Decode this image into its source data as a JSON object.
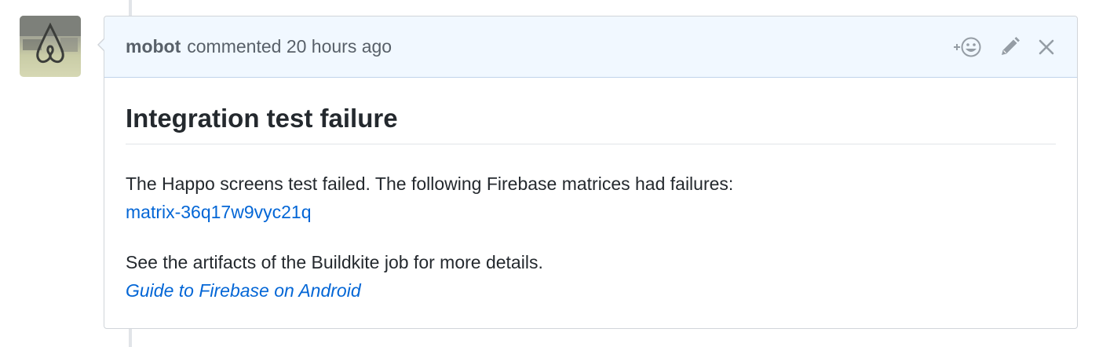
{
  "comment": {
    "author": "mobot",
    "action_text": "commented 20 hours ago",
    "title": "Integration test failure",
    "paragraph1": "The Happo screens test failed. The following Firebase matrices had failures:",
    "matrix_link": "matrix-36q17w9vyc21q",
    "paragraph2": "See the artifacts of the Buildkite job for more details.",
    "guide_link": "Guide to Firebase on Android"
  },
  "icons": {
    "avatar": "airbnb-logo-avatar",
    "reaction": "add-reaction-smiley-icon",
    "edit": "pencil-icon",
    "close": "close-x-icon"
  },
  "colors": {
    "header_bg": "#f1f8ff",
    "link": "#0366d6",
    "muted": "#586069",
    "icon": "#959da5"
  }
}
